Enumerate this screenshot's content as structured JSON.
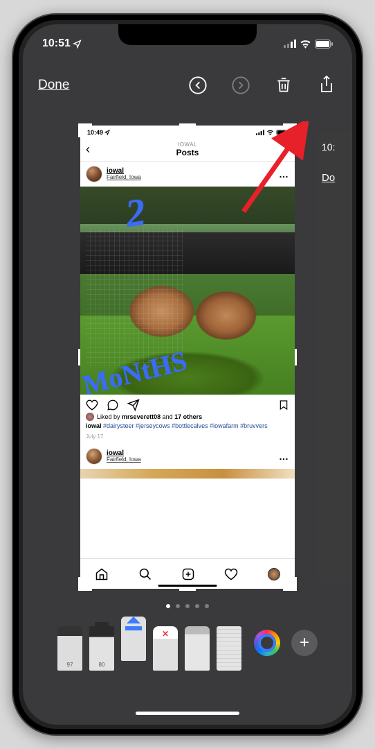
{
  "status": {
    "time": "10:51",
    "location_icon": "location-arrow"
  },
  "toolbar": {
    "done_label": "Done"
  },
  "screenshot": {
    "status_time": "10:49",
    "header_user": "IOWAL",
    "header_title": "Posts",
    "post1": {
      "username": "iowal",
      "location": "Fairfield, Iowa",
      "handwriting_top": "2",
      "handwriting_bottom": "MoNtHS",
      "likes_user": "mrseverett08",
      "likes_others": "17 others",
      "likes_prefix": "Liked by",
      "likes_and": "and",
      "caption_user": "iowal",
      "caption_tags": "#dairysteer #jerseycows #bottlecalves #iowafarm #bruvvers",
      "date": "July 17"
    },
    "post2": {
      "username": "iowal",
      "location": "Fairfield, Iowa"
    }
  },
  "next_screenshot": {
    "time": "10:",
    "done": "Do"
  },
  "pages": {
    "count": 5,
    "active": 0
  },
  "tools": {
    "pen_label": "97",
    "marker_label": "80"
  }
}
